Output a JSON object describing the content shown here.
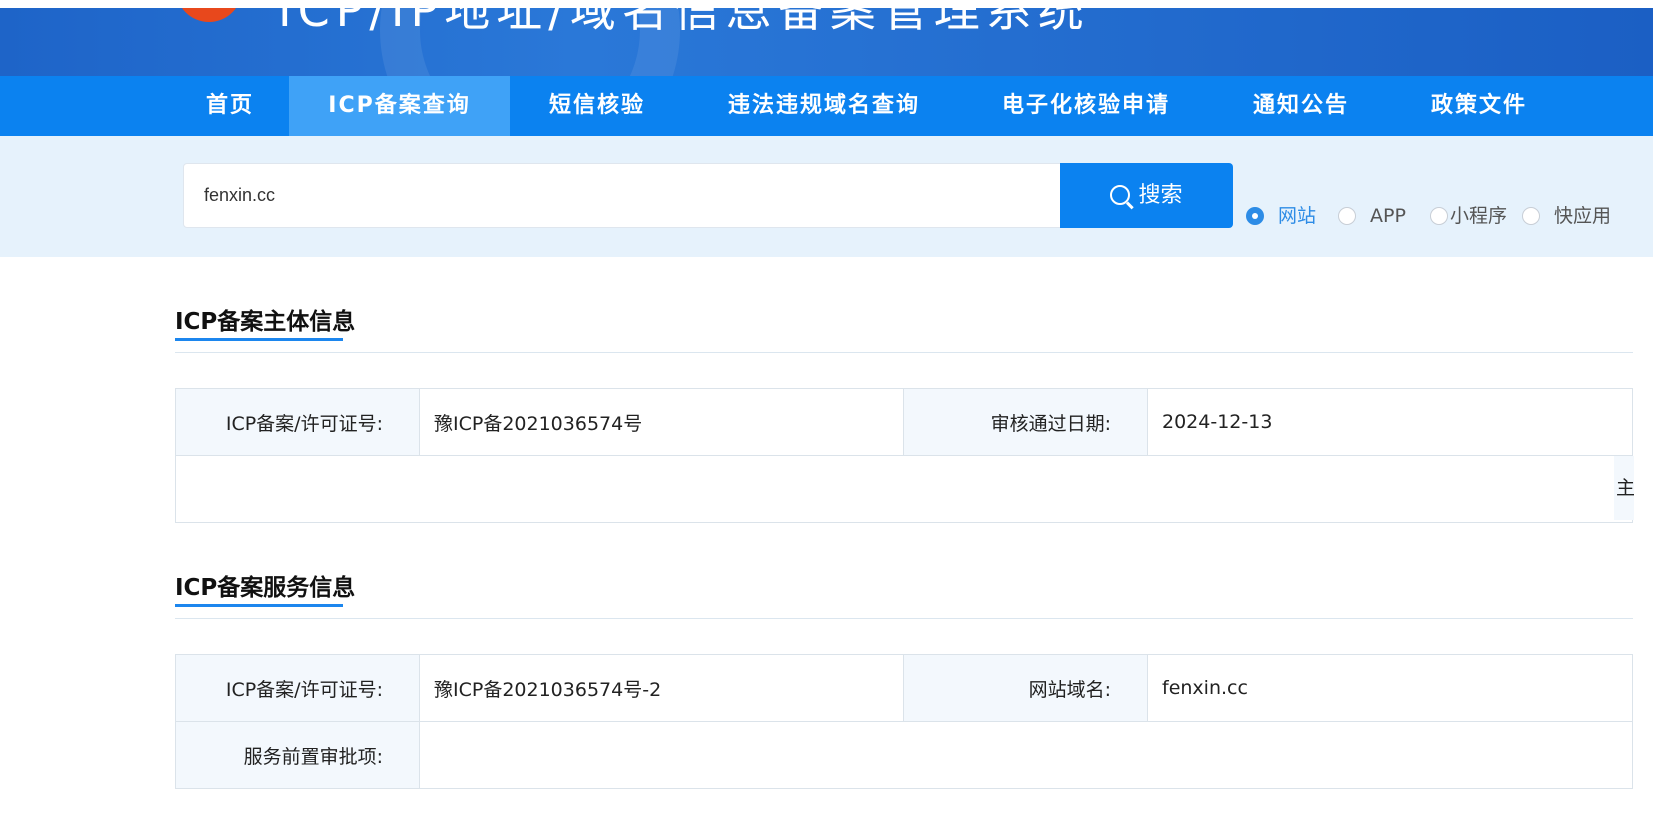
{
  "header": {
    "title": "ICP/IP地址/域名信息备案管理系统",
    "colors": {
      "banner": "#1e64c8",
      "nav": "#0b82f0",
      "nav_active": "#3fa2f7",
      "accent": "#1c86ee"
    }
  },
  "nav": {
    "items": [
      {
        "label": "首页"
      },
      {
        "label": "ICP备案查询"
      },
      {
        "label": "短信核验"
      },
      {
        "label": "违法违规域名查询"
      },
      {
        "label": "电子化核验申请"
      },
      {
        "label": "通知公告"
      },
      {
        "label": "政策文件"
      }
    ],
    "active": "ICP备案查询"
  },
  "search": {
    "value": "fenxin.cc",
    "button_label": "搜索",
    "icon": "search-icon",
    "options": [
      {
        "label": "网站",
        "checked": true
      },
      {
        "label": "APP",
        "checked": false
      },
      {
        "label": "小程序",
        "checked": false
      },
      {
        "label": "快应用",
        "checked": false
      }
    ]
  },
  "subject_section": {
    "title": "ICP备案主体信息",
    "license_label": "ICP备案/许可证号:",
    "license_value": "豫ICP备2021036574号",
    "approval_label": "审核通过日期:",
    "approval_value": "2024-12-13",
    "cut_label": "主"
  },
  "service_section": {
    "title": "ICP备案服务信息",
    "license_label": "ICP备案/许可证号:",
    "license_value": "豫ICP备2021036574号-2",
    "domain_label": "网站域名:",
    "domain_value": "fenxin.cc",
    "preapproval_label": "服务前置审批项:",
    "preapproval_value": ""
  }
}
